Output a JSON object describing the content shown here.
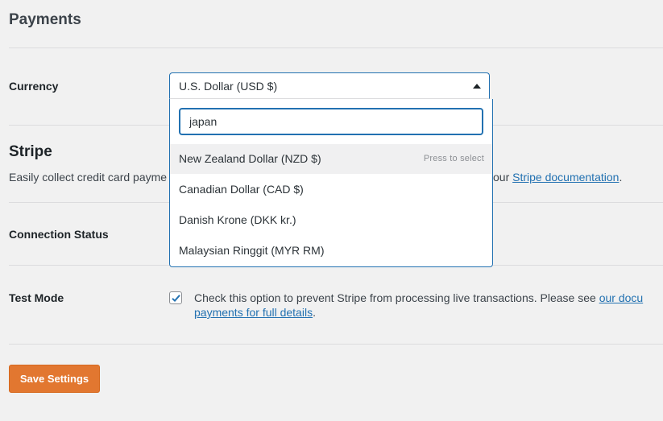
{
  "page": {
    "title": "Payments"
  },
  "currency": {
    "label": "Currency",
    "selected": "U.S. Dollar (USD $)",
    "search_value": "japan",
    "options": [
      {
        "label": "New Zealand Dollar (NZD $)",
        "hint": "Press to select"
      },
      {
        "label": "Canadian Dollar (CAD $)"
      },
      {
        "label": "Danish Krone (DKK kr.)"
      },
      {
        "label": "Malaysian Ringgit (MYR RM)"
      }
    ]
  },
  "stripe": {
    "title": "Stripe",
    "description_start": "Easily collect credit card payme",
    "description_mid": "our ",
    "doc_link": "Stripe documentation",
    "description_end": "."
  },
  "connection": {
    "label": "Connection Status"
  },
  "test_mode": {
    "label": "Test Mode",
    "checked": true,
    "text": "Check this option to prevent Stripe from processing live transactions. Please see ",
    "link1": "our docu",
    "link2": "payments for full details",
    "text_end": "."
  },
  "actions": {
    "save_label": "Save Settings"
  },
  "colors": {
    "accent": "#2271b1",
    "button": "#e27730"
  }
}
